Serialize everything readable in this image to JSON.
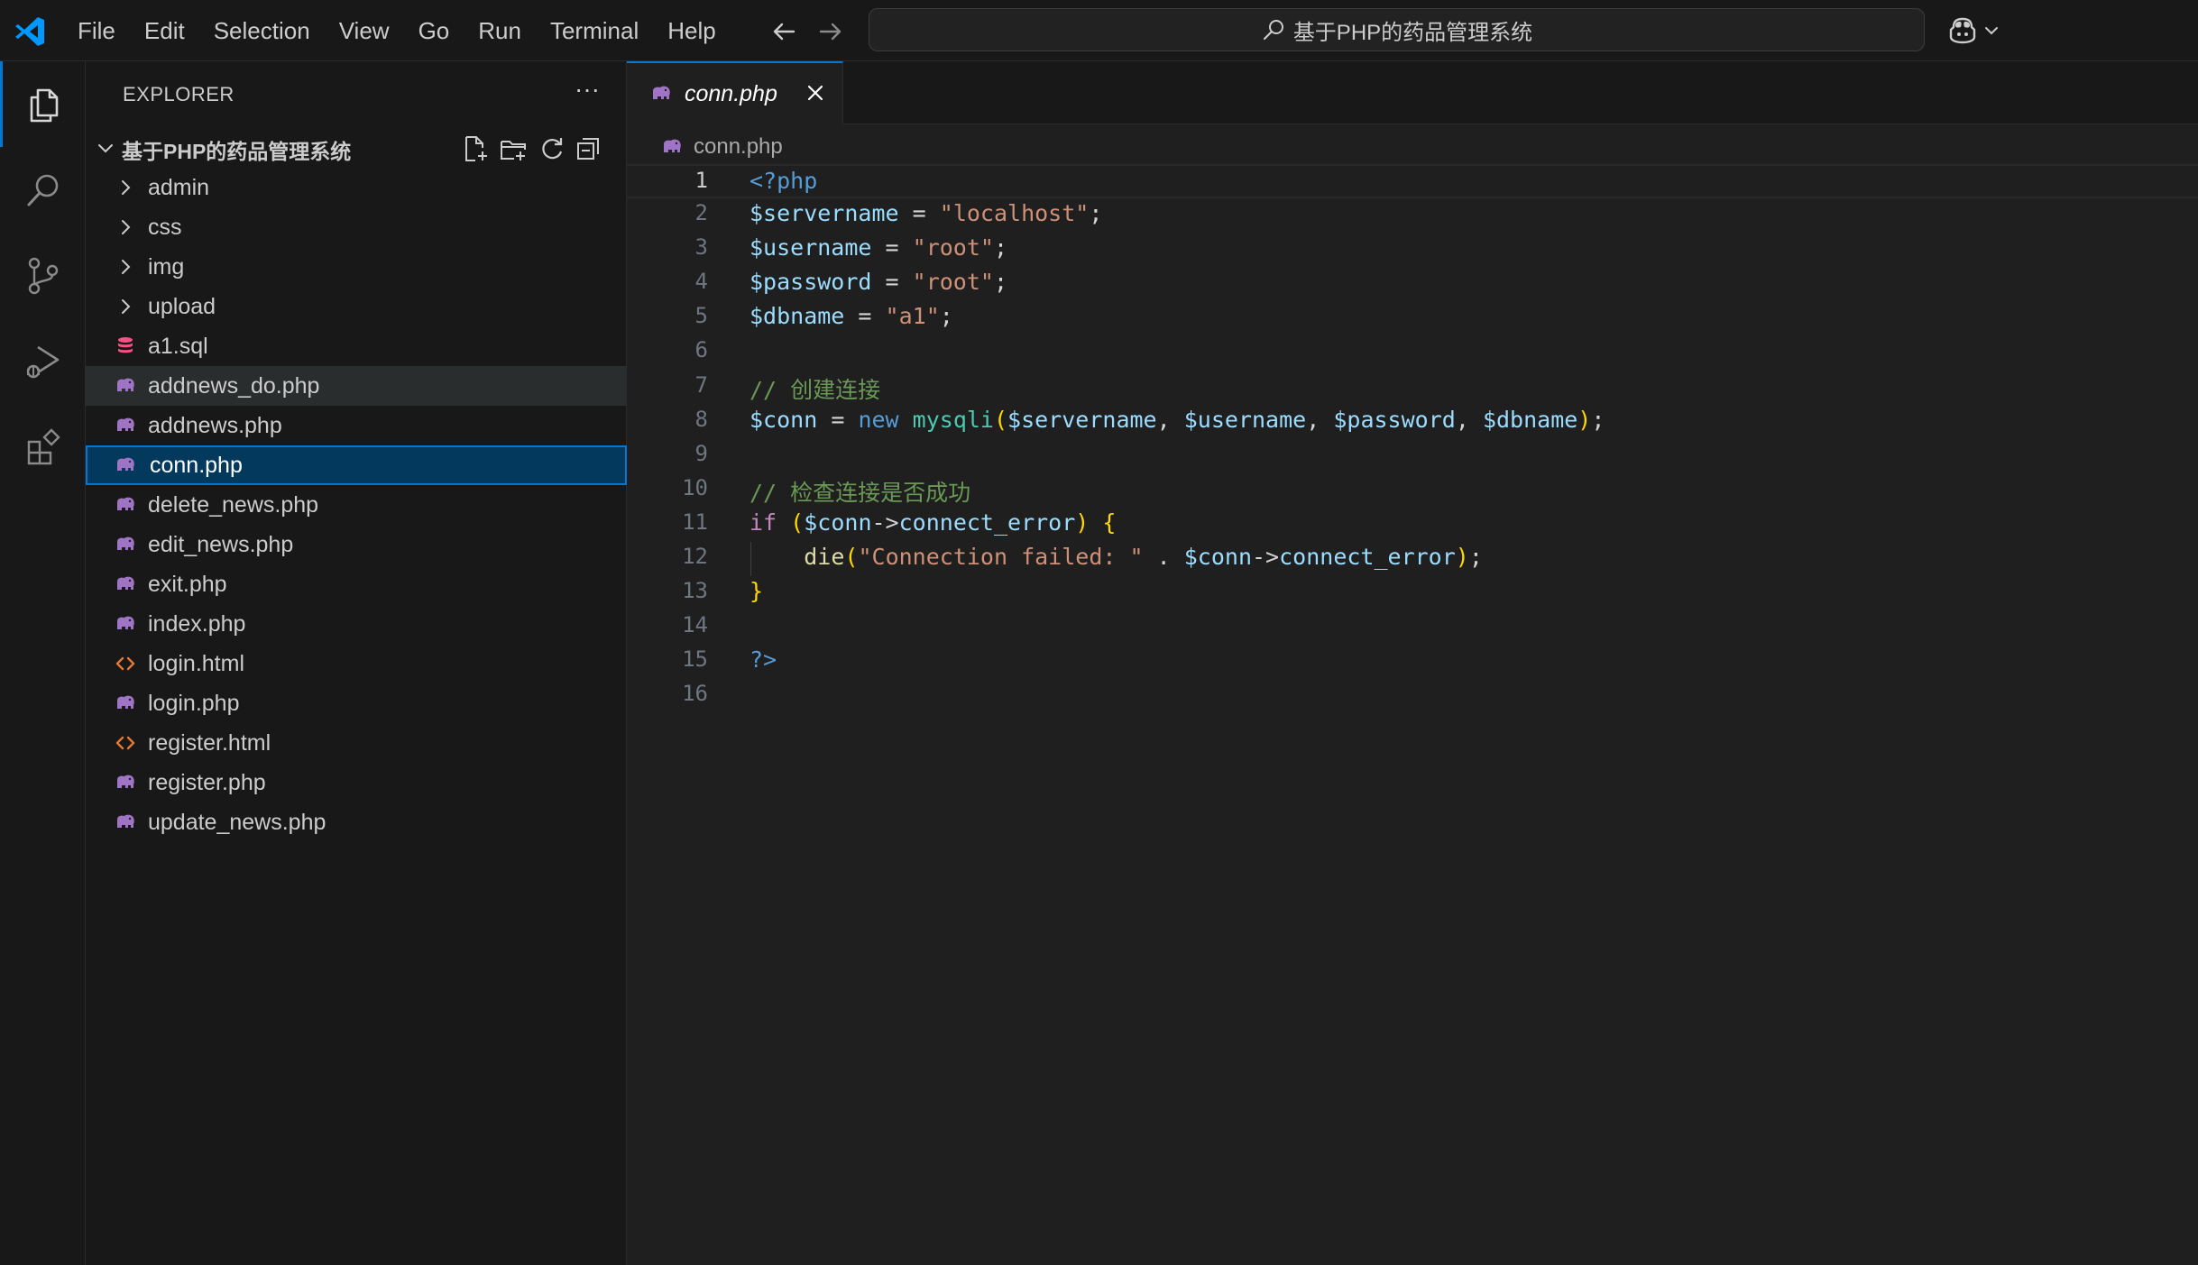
{
  "window": {
    "menu": [
      "File",
      "Edit",
      "Selection",
      "View",
      "Go",
      "Run",
      "Terminal",
      "Help"
    ],
    "command_center": "基于PHP的药品管理系统"
  },
  "activity_bar": {
    "items": [
      "explorer",
      "search",
      "source-control",
      "run-and-debug",
      "extensions"
    ],
    "active": "explorer"
  },
  "explorer": {
    "title": "EXPLORER",
    "more": "···",
    "folder_name": "基于PHP的药品管理系统",
    "tree": [
      {
        "label": "admin",
        "type": "folder"
      },
      {
        "label": "css",
        "type": "folder"
      },
      {
        "label": "img",
        "type": "folder"
      },
      {
        "label": "upload",
        "type": "folder"
      },
      {
        "label": "a1.sql",
        "type": "sql"
      },
      {
        "label": "addnews_do.php",
        "type": "php",
        "state": "hover"
      },
      {
        "label": "addnews.php",
        "type": "php"
      },
      {
        "label": "conn.php",
        "type": "php",
        "state": "selected"
      },
      {
        "label": "delete_news.php",
        "type": "php"
      },
      {
        "label": "edit_news.php",
        "type": "php"
      },
      {
        "label": "exit.php",
        "type": "php"
      },
      {
        "label": "index.php",
        "type": "php"
      },
      {
        "label": "login.html",
        "type": "html"
      },
      {
        "label": "login.php",
        "type": "php"
      },
      {
        "label": "register.html",
        "type": "html"
      },
      {
        "label": "register.php",
        "type": "php"
      },
      {
        "label": "update_news.php",
        "type": "php"
      }
    ]
  },
  "editor": {
    "tab_label": "conn.php",
    "breadcrumb": "conn.php",
    "current_line": 1,
    "line_numbers": [
      "1",
      "2",
      "3",
      "4",
      "5",
      "6",
      "7",
      "8",
      "9",
      "10",
      "11",
      "12",
      "13",
      "14",
      "15",
      "16"
    ],
    "lines": [
      "<?php",
      "$servername = \"localhost\";",
      "$username = \"root\";",
      "$password = \"root\";",
      "$dbname = \"a1\";",
      "",
      "// 创建连接",
      "$conn = new mysqli($servername, $username, $password, $dbname);",
      "",
      "// 检查连接是否成功",
      "if ($conn->connect_error) {",
      "    die(\"Connection failed: \" . $conn->connect_error);",
      "}",
      "",
      "?>",
      ""
    ]
  },
  "colors": {
    "accent": "#0078d4",
    "php_icon": "#a074c4",
    "sql_icon": "#f55385",
    "html_icon": "#e37933"
  }
}
